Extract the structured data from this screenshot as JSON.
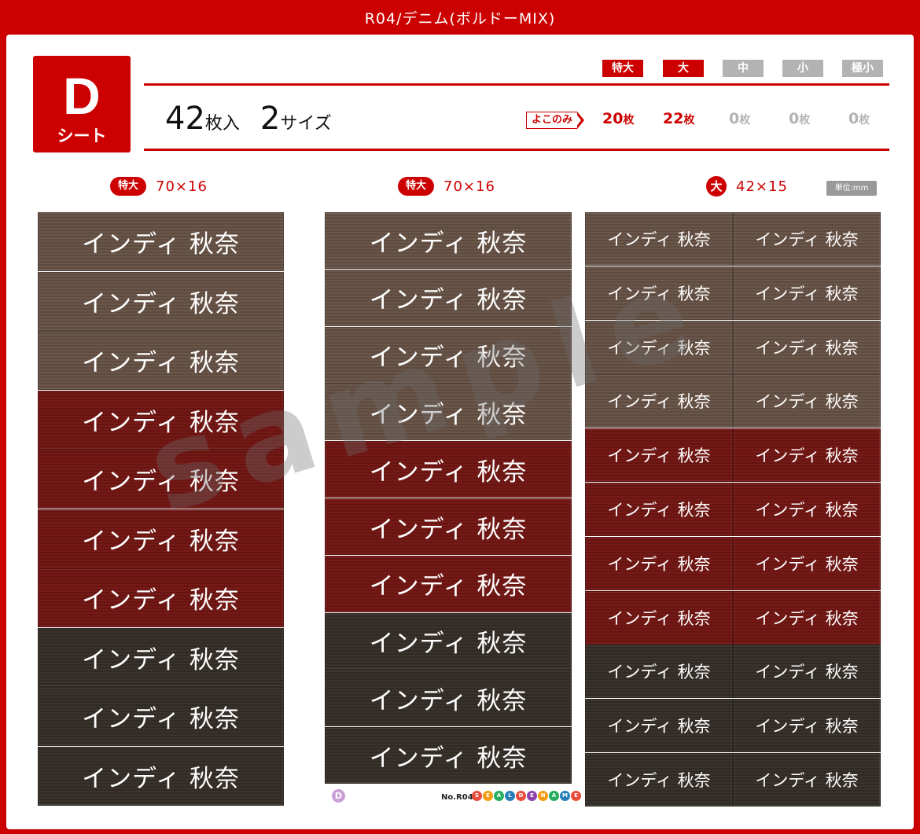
{
  "title": "R04/デニム(ボルドーMIX)",
  "badge": {
    "letter": "D",
    "sub": "シート"
  },
  "summary": {
    "count": "42",
    "count_unit": "枚入",
    "sizes": "2",
    "sizes_unit": "サイズ"
  },
  "size_pills": [
    {
      "label": "特大",
      "active": true
    },
    {
      "label": "大",
      "active": true
    },
    {
      "label": "中",
      "active": false
    },
    {
      "label": "小",
      "active": false
    },
    {
      "label": "極小",
      "active": false
    }
  ],
  "yoko_label": "よこのみ",
  "quantities": [
    {
      "num": "20",
      "unit": "枚"
    },
    {
      "num": "22",
      "unit": "枚"
    },
    {
      "num": "0",
      "unit": "枚"
    },
    {
      "num": "0",
      "unit": "枚"
    },
    {
      "num": "0",
      "unit": "枚"
    }
  ],
  "columns": [
    {
      "tag": "特大",
      "dim": "70×16"
    },
    {
      "tag": "特大",
      "dim": "70×16"
    },
    {
      "tag": "大",
      "dim": "42×15"
    }
  ],
  "unit_label": "単位:mm",
  "label_text": "インディ 秋奈",
  "watermark": "sample",
  "footer": {
    "circle": "D",
    "number": "No.R04",
    "brand": [
      "S",
      "E",
      "A",
      "L",
      "D",
      "E",
      "N",
      "A",
      "M",
      "E"
    ]
  },
  "colors": {
    "brand_red": "#cc0000",
    "inactive_gray": "#b3b3b3",
    "brown": "#6b564a",
    "bordeaux": "#761a17",
    "charcoal": "#3a332d"
  }
}
